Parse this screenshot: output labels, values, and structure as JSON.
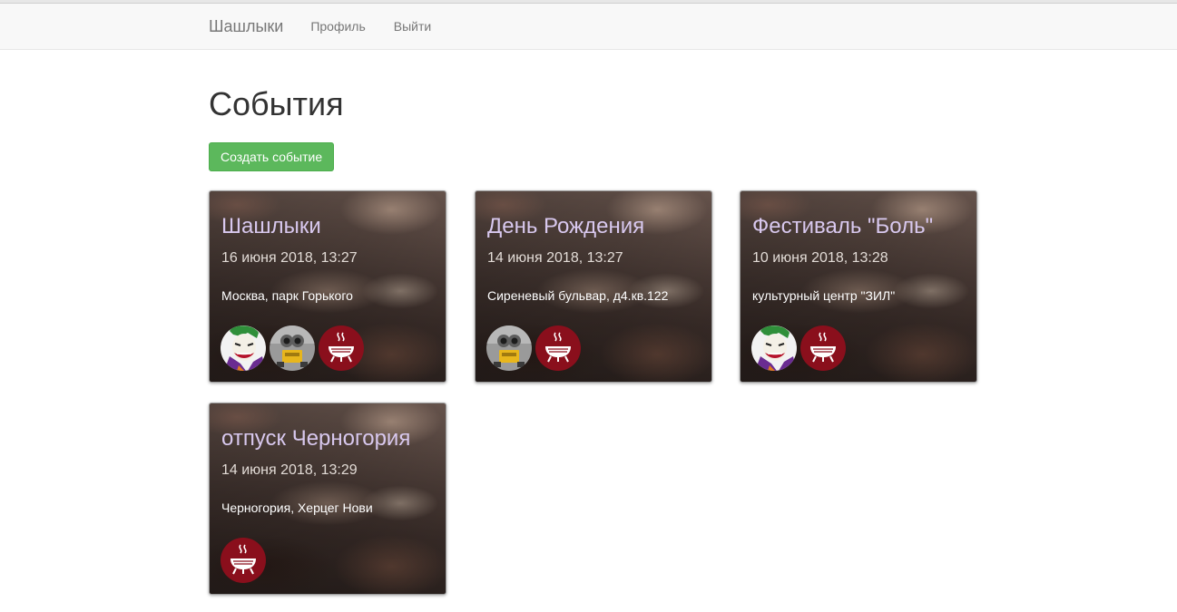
{
  "navbar": {
    "brand": "Шашлыки",
    "links": [
      "Профиль",
      "Выйти"
    ]
  },
  "page": {
    "title": "События",
    "create_button": "Создать событие"
  },
  "events": [
    {
      "title": "Шашлыки",
      "date": "16 июня 2018, 13:27",
      "address": "Москва, парк Горького",
      "participants": [
        "joker-avatar",
        "robot-avatar",
        "grill-avatar"
      ]
    },
    {
      "title": "День Рождения",
      "date": "14 июня 2018, 13:27",
      "address": "Сиреневый бульвар, д4.кв.122",
      "participants": [
        "robot-avatar",
        "grill-avatar"
      ]
    },
    {
      "title": "Фестиваль \"Боль\"",
      "date": "10 июня 2018, 13:28",
      "address": "культурный центр \"ЗИЛ\"",
      "participants": [
        "joker-avatar",
        "grill-avatar"
      ]
    },
    {
      "title": "отпуск Черногория",
      "date": "14 июня 2018, 13:29",
      "address": "Черногория, Херцег Нови",
      "participants": [
        "grill-avatar"
      ]
    }
  ],
  "colors": {
    "create_button": "#5cb85c",
    "card_title": "#d8c8ee",
    "grill_avatar": "#8a0f1c",
    "navbar": "#f8f8f8"
  }
}
